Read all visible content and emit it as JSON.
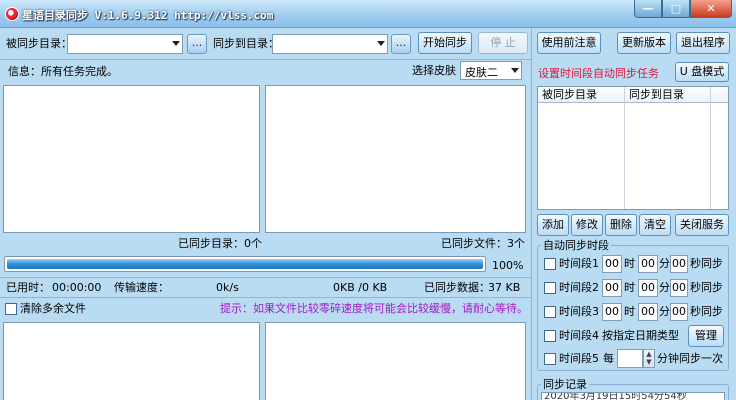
{
  "window": {
    "title": "星语目录同步 V:1.6.9.312 http://vlss.com",
    "min_glyph": "—",
    "max_glyph": "□",
    "close_glyph": "✕"
  },
  "top": {
    "source_label": "被同步目录：",
    "source_value": "",
    "source_browse": "...",
    "target_label": "同步到目录：",
    "target_value": "",
    "target_browse": "...",
    "start_button": "开始同步",
    "stop_button": "停 止"
  },
  "right_top": {
    "notice_button": "使用前注意",
    "update_button": "更新版本",
    "exit_button": "退出程序"
  },
  "info": {
    "text": "信息：所有任务完成。",
    "skin_label": "选择皮肤",
    "skin_value": "皮肤二"
  },
  "panels": {
    "left_status": "已同步目录：0个",
    "right_status": "已同步文件：3个"
  },
  "progress": {
    "percent": 100,
    "percent_text": "100%"
  },
  "stats": {
    "elapsed_label": "已用时：",
    "elapsed_value": "00:00:00",
    "speed_label": "传输速度：",
    "speed_value": "0k/s",
    "size_value": "0KB /0 KB",
    "synced_data_label": "已同步数据：",
    "synced_data_value": "37 KB"
  },
  "options": {
    "clear_extra_label": "清除多余文件",
    "hint": "提示：如果文件比较零碎速度将可能会比较缓慢，请耐心等待。"
  },
  "schedule": {
    "title": "设置时间段自动同步任务",
    "u_disk_button": "U 盘模式",
    "columns": [
      "被同步目录",
      "同步到目录"
    ],
    "buttons": {
      "add": "添加",
      "edit": "修改",
      "delete": "删除",
      "clear": "清空",
      "close_service": "关闭服务"
    }
  },
  "auto_sync": {
    "group_title": "自动同步时段",
    "periods": [
      {
        "label": "时间段1",
        "h": "00",
        "m": "00",
        "s": "00",
        "h_unit": "时",
        "m_unit": "分",
        "s_unit": "秒同步"
      },
      {
        "label": "时间段2",
        "h": "00",
        "m": "00",
        "s": "00",
        "h_unit": "时",
        "m_unit": "分",
        "s_unit": "秒同步"
      },
      {
        "label": "时间段3",
        "h": "00",
        "m": "00",
        "s": "00",
        "h_unit": "时",
        "m_unit": "分",
        "s_unit": "秒同步"
      }
    ],
    "period4_label": "时间段4",
    "period4_text": "按指定日期类型",
    "manage_button": "管理",
    "period5_label": "时间段5",
    "period5_prefix": "每",
    "period5_value": "",
    "period5_suffix": "分钟同步一次"
  },
  "log": {
    "group_title": "同步记录",
    "first_entry": "2020年3月19日15时54分54秒"
  }
}
